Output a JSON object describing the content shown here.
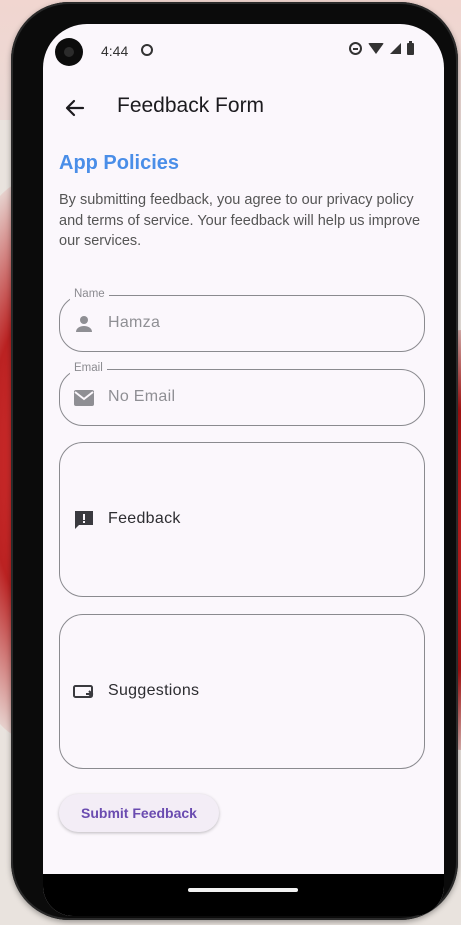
{
  "status_bar": {
    "time": "4:44"
  },
  "app_bar": {
    "title": "Feedback Form"
  },
  "policies": {
    "title": "App Policies",
    "text": "By submitting feedback, you agree to our privacy policy and terms of service. Your feedback will help us improve our services."
  },
  "form": {
    "name": {
      "label": "Name",
      "value": "Hamza"
    },
    "email": {
      "label": "Email",
      "value": "No Email"
    },
    "feedback": {
      "placeholder": "Feedback"
    },
    "suggestions": {
      "placeholder": "Suggestions"
    },
    "submit_label": "Submit Feedback"
  },
  "colors": {
    "accent": "#4a8ee8",
    "button_text": "#6a4bb0"
  }
}
